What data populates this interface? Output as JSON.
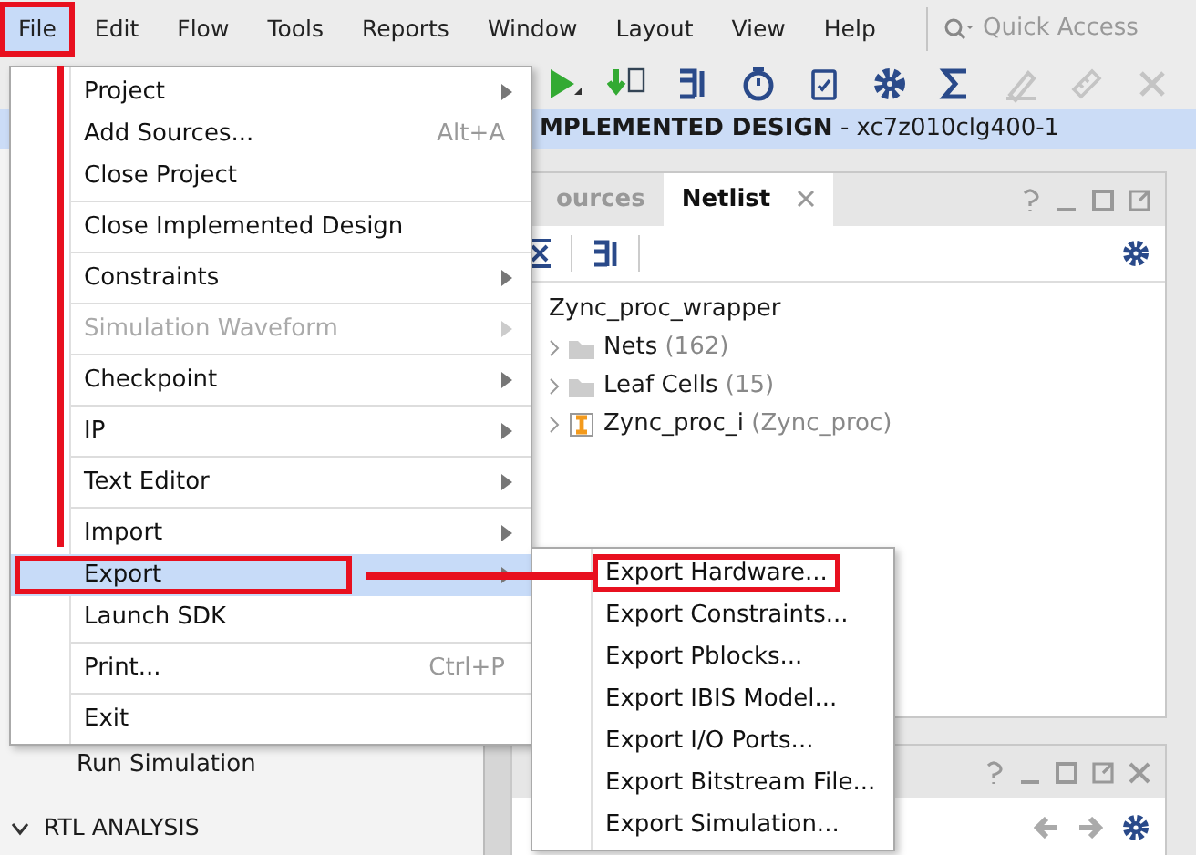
{
  "menubar": [
    {
      "label": "File",
      "selected": true,
      "highlighted": true
    },
    {
      "label": "Edit",
      "selected": false,
      "highlighted": false
    },
    {
      "label": "Flow",
      "selected": false,
      "highlighted": false
    },
    {
      "label": "Tools",
      "selected": false,
      "highlighted": false
    },
    {
      "label": "Reports",
      "selected": false,
      "highlighted": false
    },
    {
      "label": "Window",
      "selected": false,
      "highlighted": false
    },
    {
      "label": "Layout",
      "selected": false,
      "highlighted": false
    },
    {
      "label": "View",
      "selected": false,
      "highlighted": false
    },
    {
      "label": "Help",
      "selected": false,
      "highlighted": false
    }
  ],
  "quick_access": {
    "placeholder": "Quick Access"
  },
  "toolbar": [
    {
      "kind": "run",
      "disabled": false
    },
    {
      "kind": "bitstream",
      "disabled": false
    },
    {
      "kind": "route",
      "disabled": false
    },
    {
      "kind": "timer",
      "disabled": false
    },
    {
      "kind": "report",
      "disabled": false
    },
    {
      "kind": "settings",
      "disabled": false
    },
    {
      "kind": "sum",
      "disabled": false
    },
    {
      "kind": "pen",
      "disabled": true
    },
    {
      "kind": "ruler",
      "disabled": true
    },
    {
      "kind": "cross",
      "disabled": true
    }
  ],
  "header": {
    "title": "MPLEMENTED DESIGN",
    "part": " - xc7z010clg400-1"
  },
  "flow_navigator": {
    "items": [
      {
        "kind": "step",
        "label": "Run Simulation"
      },
      {
        "kind": "section",
        "label": "RTL ANALYSIS",
        "expanded": true
      }
    ]
  },
  "netlist_panel": {
    "tabs": [
      {
        "label": "ources",
        "selected": false
      },
      {
        "label": "Netlist",
        "selected": true
      }
    ],
    "tree": {
      "label": "Zync_proc_wrapper",
      "children": [
        {
          "kind": "folder",
          "label": "Nets",
          "count": "(162)",
          "expanded": false
        },
        {
          "kind": "folder",
          "label": "Leaf Cells",
          "count": "(15)",
          "expanded": false
        },
        {
          "kind": "cell",
          "label": "Zync_proc_i",
          "count": "(Zync_proc)",
          "expanded": false
        }
      ]
    }
  },
  "file_menu": {
    "items": [
      {
        "kind": "item",
        "label": "Project",
        "submenu": true,
        "disabled": false,
        "selected": false,
        "highlighted": false
      },
      {
        "kind": "item",
        "label": "Add Sources...",
        "shortcut": "Alt+A",
        "submenu": false,
        "disabled": false,
        "selected": false,
        "highlighted": false
      },
      {
        "kind": "item",
        "label": "Close Project",
        "submenu": false,
        "disabled": false,
        "selected": false,
        "highlighted": false
      },
      {
        "kind": "separator"
      },
      {
        "kind": "item",
        "label": "Close Implemented Design",
        "submenu": false,
        "disabled": false,
        "selected": false,
        "highlighted": false
      },
      {
        "kind": "separator"
      },
      {
        "kind": "item",
        "label": "Constraints",
        "submenu": true,
        "disabled": false,
        "selected": false,
        "highlighted": false
      },
      {
        "kind": "separator"
      },
      {
        "kind": "item",
        "label": "Simulation Waveform",
        "submenu": true,
        "disabled": true,
        "selected": false,
        "highlighted": false
      },
      {
        "kind": "separator"
      },
      {
        "kind": "item",
        "label": "Checkpoint",
        "submenu": true,
        "disabled": false,
        "selected": false,
        "highlighted": false
      },
      {
        "kind": "separator"
      },
      {
        "kind": "item",
        "label": "IP",
        "submenu": true,
        "disabled": false,
        "selected": false,
        "highlighted": false
      },
      {
        "kind": "separator"
      },
      {
        "kind": "item",
        "label": "Text Editor",
        "submenu": true,
        "disabled": false,
        "selected": false,
        "highlighted": false
      },
      {
        "kind": "separator"
      },
      {
        "kind": "item",
        "label": "Import",
        "submenu": true,
        "disabled": false,
        "selected": false,
        "highlighted": false
      },
      {
        "kind": "item",
        "label": "Export",
        "submenu": true,
        "disabled": false,
        "selected": true,
        "highlighted": true
      },
      {
        "kind": "item",
        "label": "Launch SDK",
        "submenu": false,
        "disabled": false,
        "selected": false,
        "highlighted": false
      },
      {
        "kind": "separator"
      },
      {
        "kind": "item",
        "label": "Print...",
        "shortcut": "Ctrl+P",
        "submenu": false,
        "disabled": false,
        "selected": false,
        "highlighted": false
      },
      {
        "kind": "separator"
      },
      {
        "kind": "item",
        "label": "Exit",
        "submenu": false,
        "disabled": false,
        "selected": false,
        "highlighted": false
      }
    ]
  },
  "export_menu": {
    "items": [
      {
        "label": "Export Hardware...",
        "highlighted": true
      },
      {
        "label": "Export Constraints...",
        "highlighted": false
      },
      {
        "label": "Export Pblocks...",
        "highlighted": false
      },
      {
        "label": "Export IBIS Model...",
        "highlighted": false
      },
      {
        "label": "Export I/O Ports...",
        "highlighted": false
      },
      {
        "label": "Export Bitstream File...",
        "highlighted": false
      },
      {
        "label": "Export Simulation...",
        "highlighted": false
      }
    ]
  },
  "annotations": {
    "connector": true,
    "margin_stroke": true
  }
}
